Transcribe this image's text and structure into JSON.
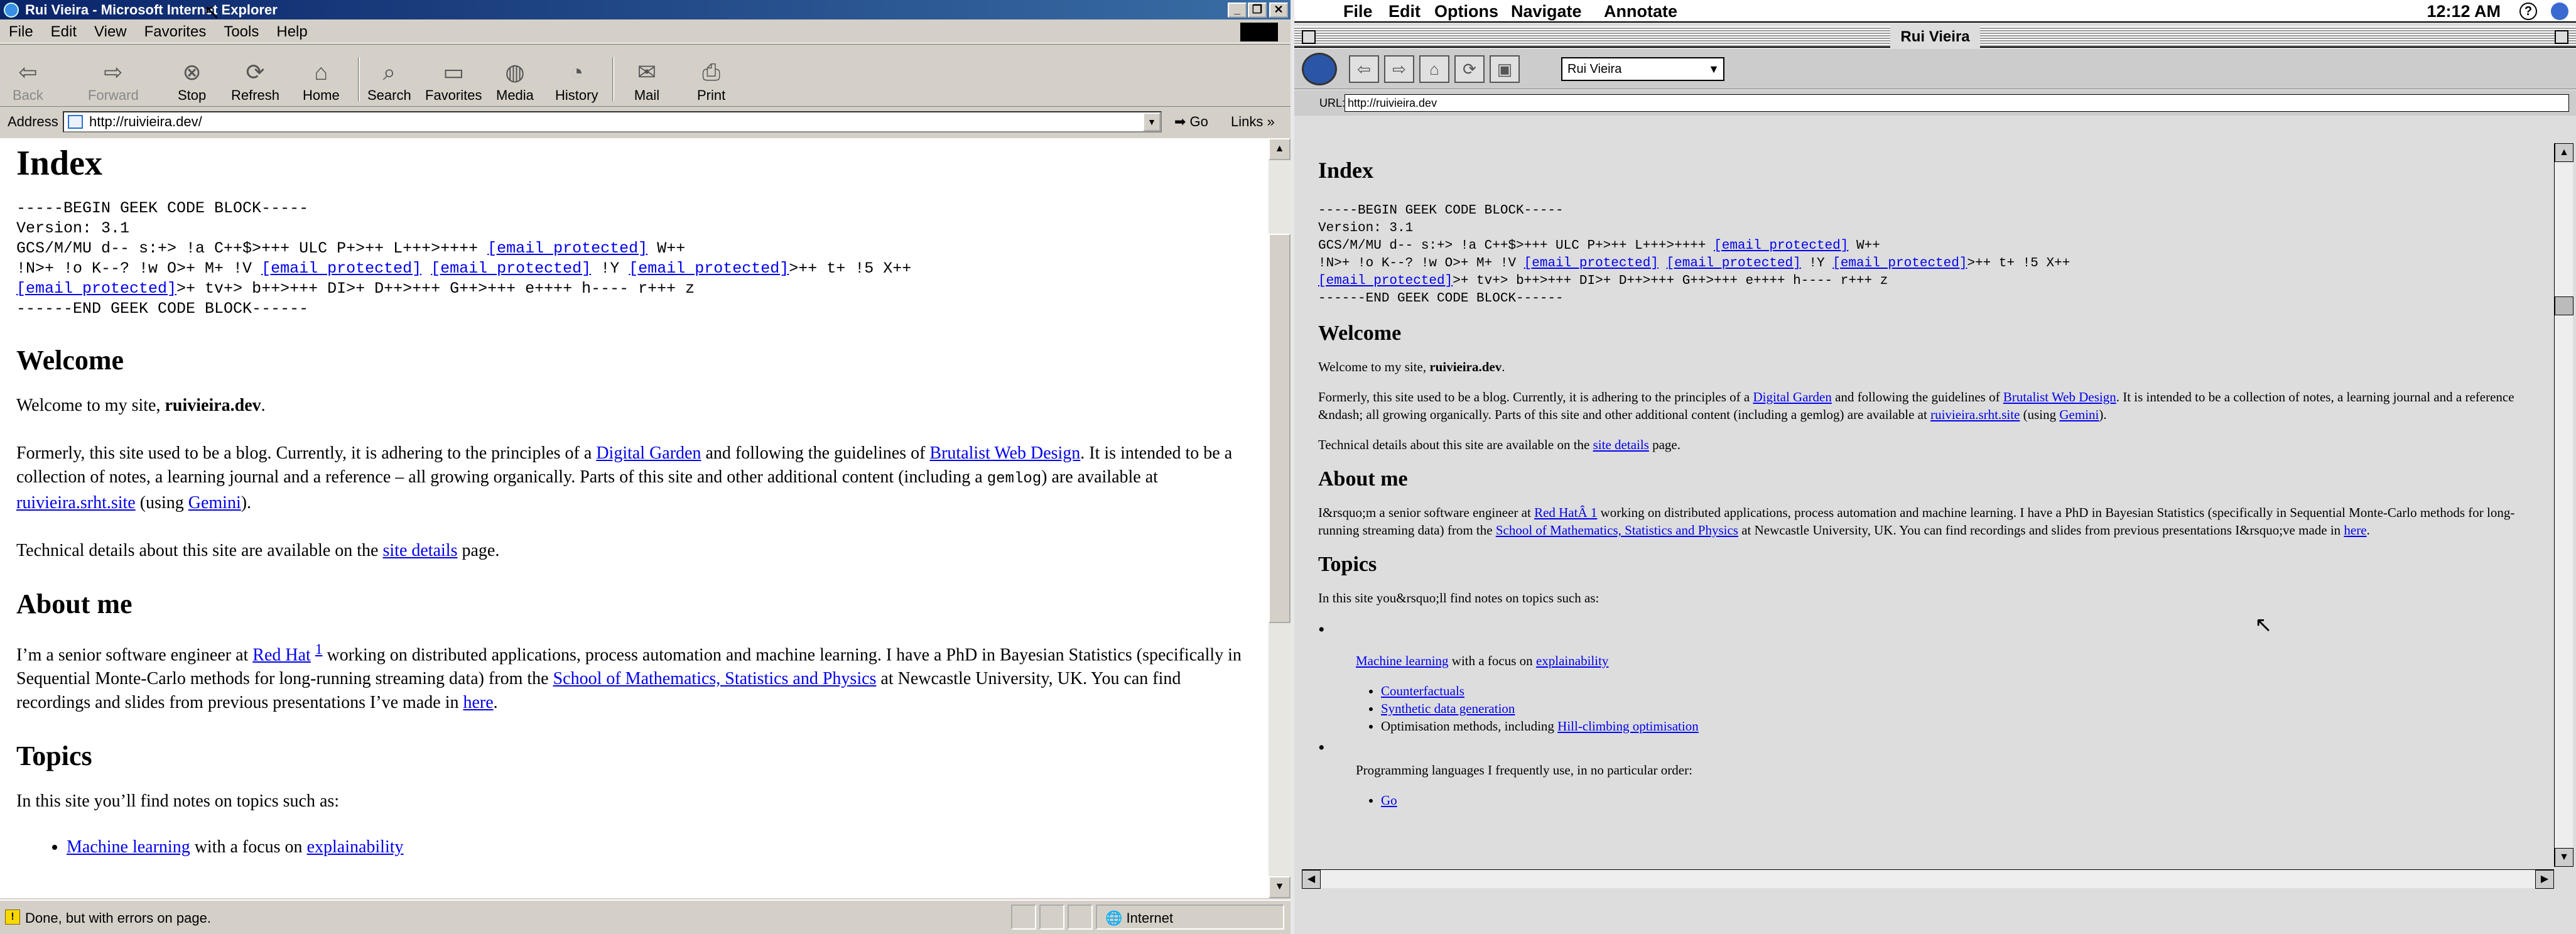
{
  "ie": {
    "title": "Rui Vieira - Microsoft Internet Explorer",
    "menu": [
      "File",
      "Edit",
      "View",
      "Favorites",
      "Tools",
      "Help"
    ],
    "toolbar": {
      "back": "Back",
      "forward": "Forward",
      "stop": "Stop",
      "refresh": "Refresh",
      "home": "Home",
      "search": "Search",
      "favorites": "Favorites",
      "media": "Media",
      "history": "History",
      "mail": "Mail",
      "print": "Print"
    },
    "address_label": "Address",
    "address_value": "http://ruivieira.dev/",
    "go": "Go",
    "links": "Links",
    "status": "Done, but with errors on page.",
    "zone": "Internet"
  },
  "mac": {
    "menu": [
      "File",
      "Edit",
      "Options",
      "Navigate",
      "Annotate"
    ],
    "clock": "12:12 AM",
    "window_title": "Rui Vieira",
    "select_value": "Rui Vieira",
    "url_label": "URL:",
    "url_value": "http://ruivieira.dev"
  },
  "page": {
    "h_index": "Index",
    "geek_begin": "-----BEGIN GEEK CODE BLOCK-----",
    "geek_version": "Version: 3.1",
    "geek_line1": "GCS/M/MU d-- s:+> !a C++$>+++ ULC P+>++ L+++>++++",
    "email": "[email protected]",
    "geek_line1_tail": "W++",
    "geek_line2_a": "!N>+ !o K--? !w O>+ M+ !V",
    "geek_line2_b": "!Y",
    "geek_line2_tail": ">++ t+ !5 X++",
    "geek_line3_tail": ">+ tv+> b++>+++ DI>+ D++>+++ G++>+++ e++++ h---- r+++ z",
    "geek_end": "------END GEEK CODE BLOCK------",
    "h_welcome": "Welcome",
    "welcome_a": "Welcome to my site, ",
    "welcome_b": "ruivieira.dev",
    "welcome_c": ".",
    "formerly_a": "Formerly, this site used to be a blog. Currently, it is adhering to the principles of a ",
    "digital_garden": "Digital Garden",
    "formerly_b": " and following the guidelines of ",
    "brutalist": "Brutalist Web Design",
    "formerly_c_ie": ". It is intended to be a collection of notes, a learning journal and a reference – all growing organically. Parts of this site and other additional content (including a ",
    "formerly_c_mac": ". It is intended to be a collection of notes, a learning journal and a reference &ndash; all growing organically. Parts of this site and other additional content (including a ",
    "gemlog": "gemlog",
    "formerly_d": ") are available at ",
    "srht": "ruivieira.srht.site",
    "formerly_e": " (using ",
    "gemini": "Gemini",
    "formerly_f": ").",
    "tech_a": "Technical details about this site are available on the ",
    "site_details": "site details",
    "tech_b": " page.",
    "h_about": "About me",
    "about_a_ie": "I’m a senior software engineer at ",
    "about_a_mac": "I&rsquo;m a senior software engineer at ",
    "redhat_ie": "Red Hat",
    "redhat_mac": "Red HatÂ ",
    "fn": "1",
    "about_b": " working on distributed applications, process automation and machine learning. I have a PhD in Bayesian Statistics (specifically in Sequential Monte-Carlo methods for long-running streaming data) from the ",
    "school": "School of Mathematics, Statistics and Physics",
    "about_c_ie": " at Newcastle University, UK.  You can find recordings and slides from previous presentations I’ve made in ",
    "about_c_mac": " at Newcastle University, UK. You can find recordings and slides from previous presentations I&rsquo;ve made in ",
    "here": "here",
    "about_d": ".",
    "h_topics": "Topics",
    "topics_ie": "In this site you’ll find notes on topics such as:",
    "topics_mac": "In this site you&rsquo;ll find notes on topics such as:",
    "ml": "Machine learning",
    "ml_mid": " with a focus on ",
    "explainability": "explainability",
    "counterfactuals": "Counterfactuals",
    "synthetic": "Synthetic data generation",
    "optim_a": "Optimisation methods, including ",
    "hill": "Hill-climbing optimisation",
    "langs": "Programming languages I frequently use, in no particular order:",
    "go_lang": "Go"
  }
}
